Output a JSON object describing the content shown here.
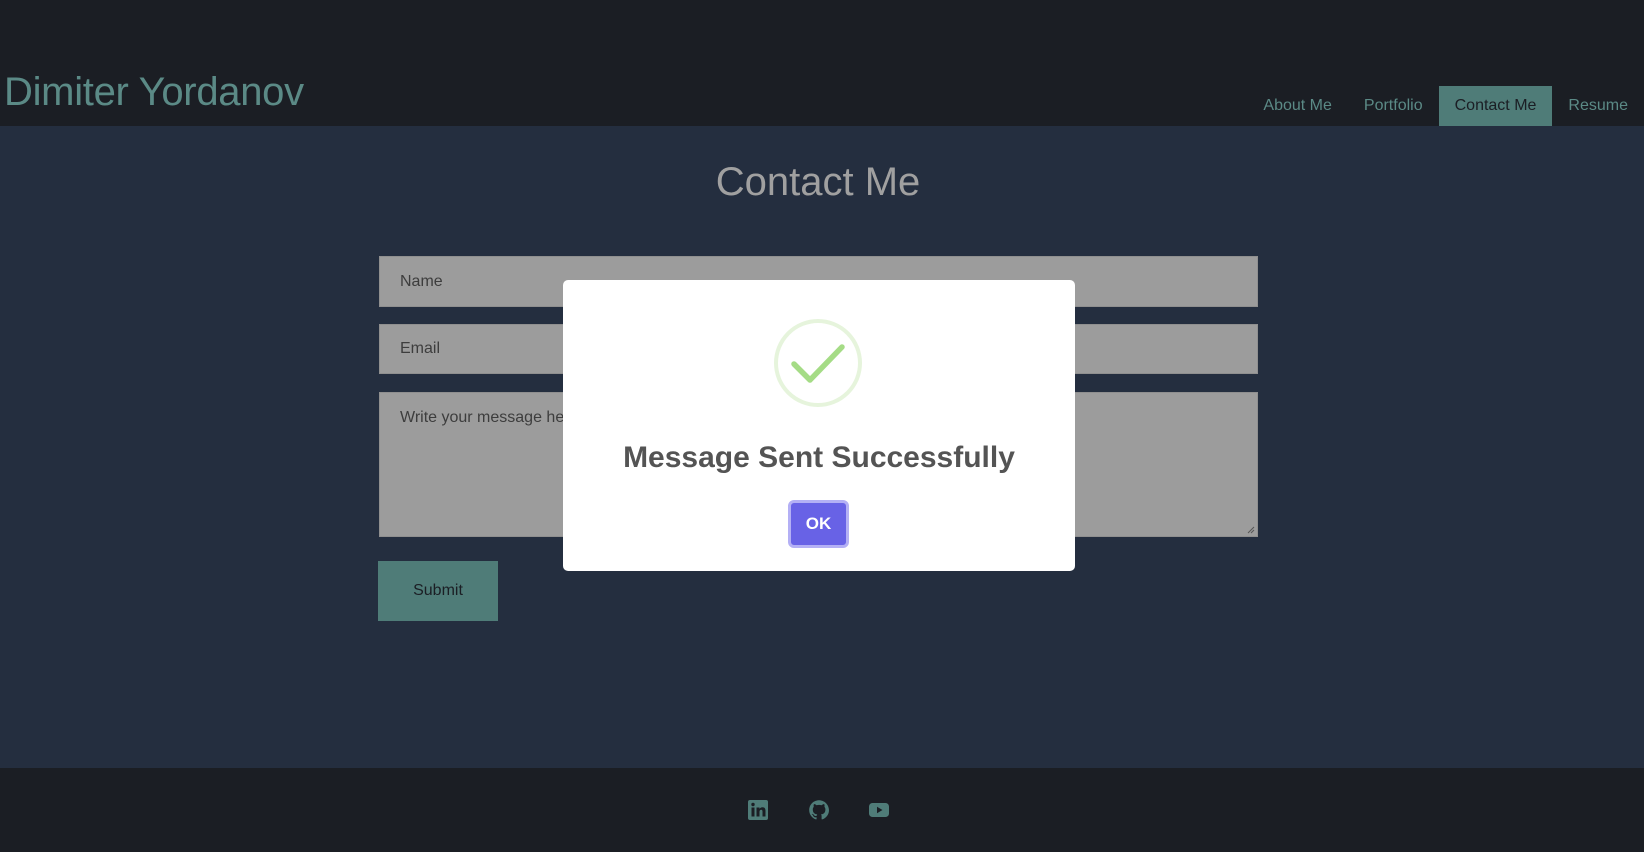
{
  "header": {
    "site_title": "Dimiter Yordanov",
    "nav": [
      {
        "label": "About Me",
        "active": false
      },
      {
        "label": "Portfolio",
        "active": false
      },
      {
        "label": "Contact Me",
        "active": true
      },
      {
        "label": "Resume",
        "active": false
      }
    ]
  },
  "main": {
    "page_title": "Contact Me",
    "form": {
      "name_placeholder": "Name",
      "email_placeholder": "Email",
      "message_placeholder": "Write your message here",
      "submit_label": "Submit"
    }
  },
  "footer": {
    "social_icons": [
      "linkedin-icon",
      "github-icon",
      "youtube-icon"
    ]
  },
  "modal": {
    "icon": "success-check-icon",
    "title": "Message Sent Successfully",
    "ok_label": "OK"
  },
  "colors": {
    "header_bg": "#1b1e24",
    "main_bg": "#242e3f",
    "accent": "#5b8a86",
    "field_bg": "#9c9c9c",
    "ok_button": "#6862e6",
    "success_green": "#a5dc86"
  }
}
